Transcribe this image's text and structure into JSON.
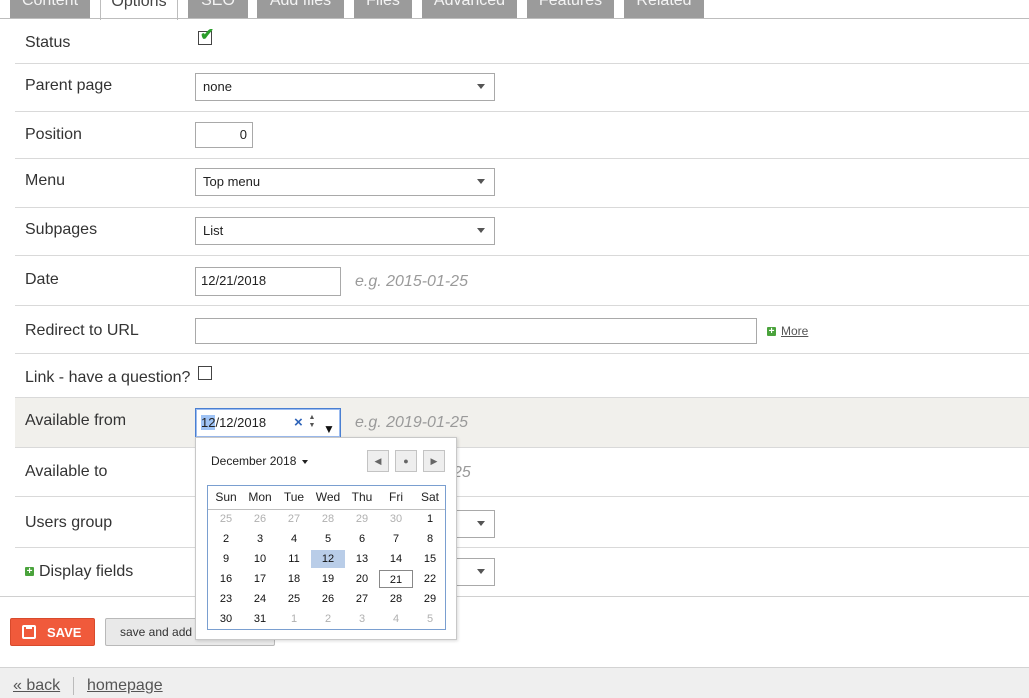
{
  "tabs": [
    "Content",
    "Options",
    "SEO",
    "Add files",
    "Files",
    "Advanced",
    "Features",
    "Related"
  ],
  "active_tab": "Options",
  "form": {
    "status_label": "Status",
    "status_checked": true,
    "parent_label": "Parent page",
    "parent_value": "none",
    "position_label": "Position",
    "position_value": "0",
    "menu_label": "Menu",
    "menu_value": "Top menu",
    "subpages_label": "Subpages",
    "subpages_value": "List",
    "date_label": "Date",
    "date_value": "12/21/2018",
    "date_hint": "e.g. 2015-01-25",
    "redirect_label": "Redirect to URL",
    "redirect_value": "",
    "more_label": "More",
    "link_label": "Link - have a question?",
    "link_checked": false,
    "available_from_label": "Available from",
    "available_from_month": "12",
    "available_from_rest": "/12/2018",
    "available_from_hint": "e.g. 2019-01-25",
    "available_to_label": "Available to",
    "available_to_hint_partial": "25",
    "users_group_label": "Users group",
    "display_fields_label": "Display fields"
  },
  "calendar": {
    "month_label": "December 2018",
    "weekdays": [
      "Sun",
      "Mon",
      "Tue",
      "Wed",
      "Thu",
      "Fri",
      "Sat"
    ],
    "weeks": [
      [
        "25",
        "26",
        "27",
        "28",
        "29",
        "30",
        "1"
      ],
      [
        "2",
        "3",
        "4",
        "5",
        "6",
        "7",
        "8"
      ],
      [
        "9",
        "10",
        "11",
        "12",
        "13",
        "14",
        "15"
      ],
      [
        "16",
        "17",
        "18",
        "19",
        "20",
        "21",
        "22"
      ],
      [
        "23",
        "24",
        "25",
        "26",
        "27",
        "28",
        "29"
      ],
      [
        "30",
        "31",
        "1",
        "2",
        "3",
        "4",
        "5"
      ]
    ],
    "selected_day": "12",
    "today_day": "21"
  },
  "buttons": {
    "save_label": "SAVE",
    "secondary_label": "save and add"
  },
  "footer": {
    "back_label": "« back",
    "homepage_label": "homepage"
  },
  "colors": {
    "save_bg": "#f05a3b",
    "tab_bg": "#9b9b9b",
    "highlight_row": "#f1f0ec"
  }
}
